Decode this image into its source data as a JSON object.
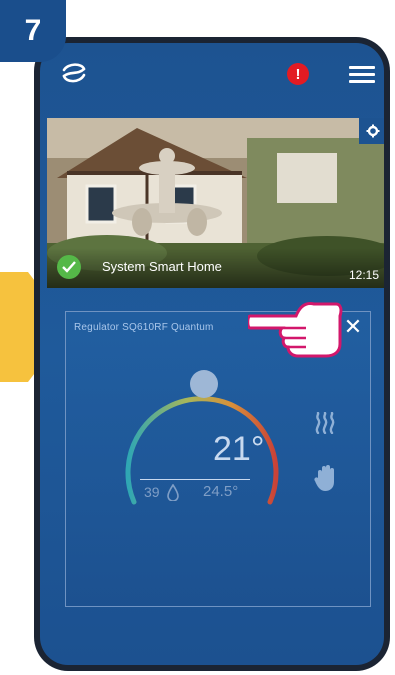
{
  "step": {
    "number": "7"
  },
  "colors": {
    "accent": "#1d5391",
    "alert": "#e31b23",
    "status_ok": "#55b848",
    "arrow": "#f6c23e",
    "pointer": "#d2176b"
  },
  "topbar": {
    "logo_icon": "logo-icon",
    "alert_label": "!",
    "menu_icon": "hamburger-menu-icon"
  },
  "photo": {
    "system_name": "System Smart Home",
    "time": "12:15",
    "gear_icon": "gear-icon",
    "status_icon": "check-icon"
  },
  "device": {
    "title": "Regulator SQ610RF Quantum",
    "close_label": "✕",
    "temperature": "21°",
    "humidity": "39",
    "current_temperature": "24.5°",
    "icons": [
      "thermometer-gauge",
      "drop-icon",
      "heating-icon",
      "manual-mode-hand-icon"
    ]
  }
}
